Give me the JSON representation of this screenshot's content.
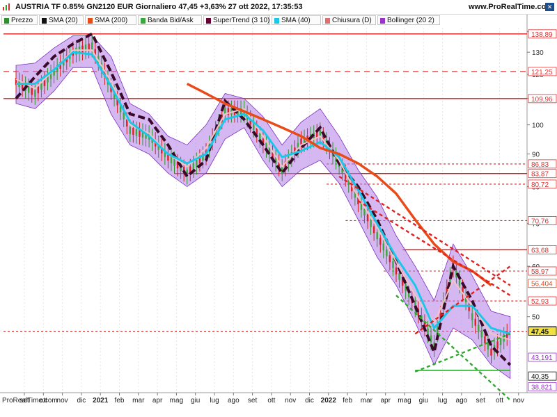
{
  "header": {
    "title": "AUSTRIA TF 0.85% GN2120 EUR Giornaliero 47,45 +3,63% 27 ott 2022, 17:35:53",
    "site": "www.ProRealTime.com",
    "close_icon": "close-x"
  },
  "legend": [
    {
      "label": "Prezzo",
      "color": "#2f8f2f"
    },
    {
      "label": "SMA (20)",
      "color": "#111111"
    },
    {
      "label": "SMA (200)",
      "color": "#e84a18"
    },
    {
      "label": "Banda Bid/Ask",
      "color": "#3aa83a"
    },
    {
      "label": "SuperTrend (3 10)",
      "color": "#660033"
    },
    {
      "label": "SMA (40)",
      "color": "#19c8e8"
    },
    {
      "label": "Chiusura (D)",
      "color": "#e07070"
    },
    {
      "label": "Bollinger (20 2)",
      "color": "#9933cc"
    }
  ],
  "watermark": "ProRealTime.com",
  "chart_data": {
    "type": "candlestick",
    "y_scale": "log",
    "y_ticks": [
      "140",
      "130",
      "120",
      "110",
      "100",
      "90",
      "80",
      "70",
      "60",
      "50"
    ],
    "x_ticks": [
      "set",
      "ott",
      "nov",
      "dic",
      "2021",
      "feb",
      "mar",
      "apr",
      "mag",
      "giu",
      "lug",
      "ago",
      "set",
      "ott",
      "nov",
      "dic",
      "2022",
      "feb",
      "mar",
      "apr",
      "mag",
      "giu",
      "lug",
      "ago",
      "set",
      "ott",
      "nov"
    ],
    "x_range": [
      "2020-09",
      "2022-11"
    ],
    "y_range": [
      38,
      142
    ],
    "last_price": 47.45,
    "price_labels": [
      {
        "text": "138,89",
        "value": 138.89,
        "color": "#e03030",
        "bg": "#ffffff"
      },
      {
        "text": "121,25",
        "value": 121.25,
        "color": "#e03030",
        "bg": "#ffffff"
      },
      {
        "text": "109,96",
        "value": 109.96,
        "color": "#e03030",
        "bg": "#ffffff"
      },
      {
        "text": "86,83",
        "value": 86.83,
        "color": "#e03030",
        "bg": "#ffffff"
      },
      {
        "text": "83,87",
        "value": 83.87,
        "color": "#e03030",
        "bg": "#ffffff"
      },
      {
        "text": "80,72",
        "value": 80.72,
        "color": "#e03030",
        "bg": "#ffffff"
      },
      {
        "text": "70,76",
        "value": 70.76,
        "color": "#e03030",
        "bg": "#ffffff"
      },
      {
        "text": "63,68",
        "value": 63.68,
        "color": "#e03030",
        "bg": "#ffffff"
      },
      {
        "text": "58,97",
        "value": 58.97,
        "color": "#e03030",
        "bg": "#ffffff"
      },
      {
        "text": "56,404",
        "value": 56.404,
        "color": "#e84a18",
        "bg": "#ffffff"
      },
      {
        "text": "52,93",
        "value": 52.93,
        "color": "#e03030",
        "bg": "#ffffff"
      },
      {
        "text": "47,561",
        "value": 47.561,
        "color": "#9933cc",
        "bg": "#ffffff"
      },
      {
        "text": "47,45",
        "value": 47.45,
        "color": "#111111",
        "bg": "#f0e040"
      },
      {
        "text": "43,191",
        "value": 43.191,
        "color": "#9933cc",
        "bg": "#ffffff"
      },
      {
        "text": "40,35",
        "value": 40.35,
        "color": "#111111",
        "bg": "#ffffff"
      },
      {
        "text": "38,821",
        "value": 38.821,
        "color": "#9933cc",
        "bg": "#ffffff"
      }
    ],
    "support_resistance_lines": [
      {
        "value": 138.89,
        "style": "solid",
        "start": "2020-09"
      },
      {
        "value": 121.25,
        "style": "dashed",
        "start": "2020-09"
      },
      {
        "value": 109.96,
        "style": "solid",
        "start": "2020-09"
      },
      {
        "value": 86.83,
        "style": "dashed",
        "start": "2022-02"
      },
      {
        "value": 83.87,
        "style": "solid",
        "start": "2021-06"
      },
      {
        "value": 80.72,
        "style": "dashed",
        "start": "2022-02"
      },
      {
        "value": 70.76,
        "style": "dashed",
        "start": "2022-03"
      },
      {
        "value": 63.68,
        "style": "solid",
        "start": "2022-06"
      },
      {
        "value": 58.97,
        "style": "dashed",
        "start": "2022-05"
      },
      {
        "value": 52.93,
        "style": "dashed",
        "start": "2022-06"
      },
      {
        "value": 47.45,
        "style": "dashed",
        "start": "2020-09"
      }
    ],
    "series": [
      {
        "name": "SMA (20)",
        "x": [
          "2020-09",
          "2020-10",
          "2020-11",
          "2020-12",
          "2021-01",
          "2021-02",
          "2021-03",
          "2021-04",
          "2021-05",
          "2021-06",
          "2021-07",
          "2021-08",
          "2021-09",
          "2021-10",
          "2021-11",
          "2021-12",
          "2022-01",
          "2022-02",
          "2022-03",
          "2022-04",
          "2022-05",
          "2022-06",
          "2022-07",
          "2022-08",
          "2022-09",
          "2022-10",
          "2022-11"
        ],
        "values": [
          118,
          114,
          122,
          131,
          131,
          117,
          100,
          97,
          90,
          86,
          92,
          104,
          106,
          96,
          86,
          93,
          96,
          88,
          77,
          69,
          61,
          54,
          49,
          57,
          52,
          47,
          46
        ]
      },
      {
        "name": "SMA (40)",
        "x": [
          "2020-09",
          "2020-10",
          "2020-11",
          "2020-12",
          "2021-01",
          "2021-02",
          "2021-03",
          "2021-04",
          "2021-05",
          "2021-06",
          "2021-07",
          "2021-08",
          "2021-09",
          "2021-10",
          "2021-11",
          "2021-12",
          "2022-01",
          "2022-02",
          "2022-03",
          "2022-04",
          "2022-05",
          "2022-06",
          "2022-07",
          "2022-08",
          "2022-09",
          "2022-10",
          "2022-11"
        ],
        "values": [
          116,
          116,
          122,
          130,
          129,
          115,
          101,
          96,
          90,
          87,
          90,
          102,
          104,
          98,
          89,
          91,
          94,
          89,
          79,
          70,
          62,
          56,
          48,
          52,
          52,
          48,
          47
        ]
      },
      {
        "name": "SMA (200)",
        "x": [
          "2021-06",
          "2021-07",
          "2021-08",
          "2021-09",
          "2021-10",
          "2021-11",
          "2021-12",
          "2022-01",
          "2022-02",
          "2022-03",
          "2022-04",
          "2022-05",
          "2022-06",
          "2022-07",
          "2022-08",
          "2022-09",
          "2022-10"
        ],
        "values": [
          116,
          112,
          108,
          105,
          102,
          99,
          96,
          92,
          90,
          87,
          83,
          78,
          71,
          65,
          61,
          59,
          56
        ]
      },
      {
        "name": "SuperTrend (3 10)",
        "x": [
          "2020-09",
          "2020-10",
          "2020-11",
          "2020-12",
          "2021-01",
          "2021-02",
          "2021-03",
          "2021-04",
          "2021-05",
          "2021-06",
          "2021-07",
          "2021-08",
          "2021-09",
          "2021-10",
          "2021-11",
          "2021-12",
          "2022-01",
          "2022-02",
          "2022-03",
          "2022-04",
          "2022-05",
          "2022-06",
          "2022-07",
          "2022-08",
          "2022-09",
          "2022-10",
          "2022-11"
        ],
        "values": [
          110,
          119,
          128,
          134,
          139,
          121,
          104,
          102,
          93,
          83,
          88,
          109,
          102,
          93,
          84,
          92,
          99,
          87,
          80,
          71,
          61,
          52,
          44,
          60,
          53,
          45,
          42
        ]
      },
      {
        "name": "Bollinger (20 2)",
        "x": [
          "2020-09",
          "2020-10",
          "2020-11",
          "2020-12",
          "2021-01",
          "2021-02",
          "2021-03",
          "2021-04",
          "2021-05",
          "2021-06",
          "2021-07",
          "2021-08",
          "2021-09",
          "2021-10",
          "2021-11",
          "2021-12",
          "2022-01",
          "2022-02",
          "2022-03",
          "2022-04",
          "2022-05",
          "2022-06",
          "2022-07",
          "2022-08",
          "2022-09",
          "2022-10",
          "2022-11"
        ],
        "upper": [
          124,
          125,
          132,
          138,
          138,
          128,
          108,
          104,
          96,
          93,
          100,
          112,
          110,
          103,
          93,
          101,
          106,
          96,
          85,
          77,
          67,
          60,
          53,
          65,
          58,
          51,
          50
        ],
        "lower": [
          108,
          106,
          113,
          123,
          123,
          104,
          93,
          90,
          84,
          80,
          84,
          95,
          99,
          88,
          80,
          85,
          88,
          81,
          71,
          62,
          56,
          49,
          42,
          48,
          46,
          42,
          40
        ]
      },
      {
        "name": "Prezzo",
        "x": [
          "2020-09",
          "2020-10",
          "2020-11",
          "2020-12",
          "2021-01",
          "2021-02",
          "2021-03",
          "2021-04",
          "2021-05",
          "2021-06",
          "2021-07",
          "2021-08",
          "2021-09",
          "2021-10",
          "2021-11",
          "2021-12",
          "2022-01",
          "2022-02",
          "2022-03",
          "2022-04",
          "2022-05",
          "2022-06",
          "2022-07",
          "2022-08",
          "2022-09",
          "2022-10",
          "2022-11"
        ],
        "values": [
          117,
          112,
          121,
          130,
          133,
          114,
          98,
          96,
          89,
          84,
          90,
          105,
          105,
          94,
          85,
          94,
          97,
          87,
          76,
          67,
          59,
          52,
          45,
          60,
          50,
          44,
          47.45
        ]
      }
    ],
    "trendlines": [
      {
        "color": "#e02020",
        "style": "dashed",
        "from": [
          "2022-03",
          76
        ],
        "to": [
          "2022-11",
          54
        ]
      },
      {
        "color": "#e02020",
        "style": "dashed",
        "from": [
          "2022-02",
          83
        ],
        "to": [
          "2022-11",
          56
        ]
      },
      {
        "color": "#e02020",
        "style": "dashed",
        "from": [
          "2022-06",
          47
        ],
        "to": [
          "2022-11",
          60
        ]
      },
      {
        "color": "#2ea82e",
        "style": "dashed",
        "from": [
          "2022-05",
          54
        ],
        "to": [
          "2022-11",
          37
        ]
      },
      {
        "color": "#2ea82e",
        "style": "dashed",
        "from": [
          "2022-06",
          41
        ],
        "to": [
          "2022-11",
          47
        ]
      },
      {
        "color": "#2ea82e",
        "style": "solid",
        "from": [
          "2022-06",
          41.2
        ],
        "to": [
          "2022-11",
          41.2
        ]
      }
    ]
  }
}
